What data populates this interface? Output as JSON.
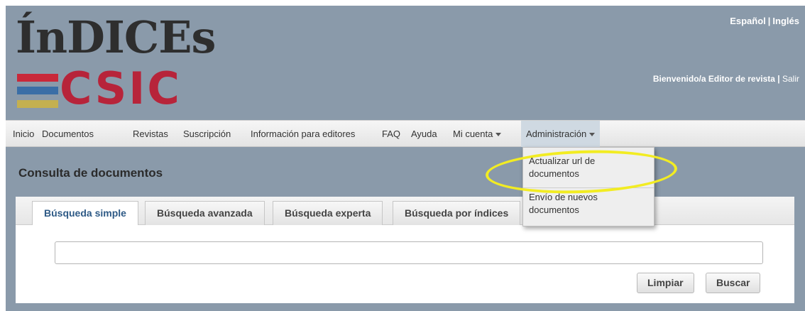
{
  "header": {
    "logo": {
      "top_text": "ÍnDICEs",
      "bottom_text": "CSIC"
    },
    "languages": [
      "Español",
      "Inglés"
    ],
    "language_separator": "|",
    "welcome": {
      "label": "Bienvenido/a Editor de revista",
      "separator": "|",
      "logout": "Salir"
    }
  },
  "nav": {
    "items": [
      {
        "label": "Inicio"
      },
      {
        "label": "Documentos"
      },
      {
        "label": "Revistas"
      },
      {
        "label": "Suscripción"
      },
      {
        "label": "Información para editores"
      },
      {
        "label": "FAQ"
      },
      {
        "label": "Ayuda"
      },
      {
        "label": "Mi cuenta"
      },
      {
        "label": "Administración"
      }
    ]
  },
  "dropdown": {
    "items": [
      {
        "line1": "Actualizar url de",
        "line2": "documentos"
      },
      {
        "line1": "Envío de nuevos",
        "line2": "documentos"
      }
    ]
  },
  "content": {
    "title": "Consulta de documentos",
    "tabs": [
      {
        "label": "Búsqueda simple"
      },
      {
        "label": "Búsqueda avanzada"
      },
      {
        "label": "Búsqueda experta"
      },
      {
        "label": "Búsqueda por índices"
      }
    ],
    "search": {
      "value": "",
      "placeholder": ""
    },
    "buttons": {
      "clear": "Limpiar",
      "search": "Buscar"
    }
  },
  "colors": {
    "page_background": "#8a9aaa",
    "logo_red": "#c9283a",
    "logo_blue": "#3a6ea6",
    "logo_yellow": "#c4b050",
    "highlight": "#f2ec22",
    "active_nav": "#cfd9e2"
  }
}
